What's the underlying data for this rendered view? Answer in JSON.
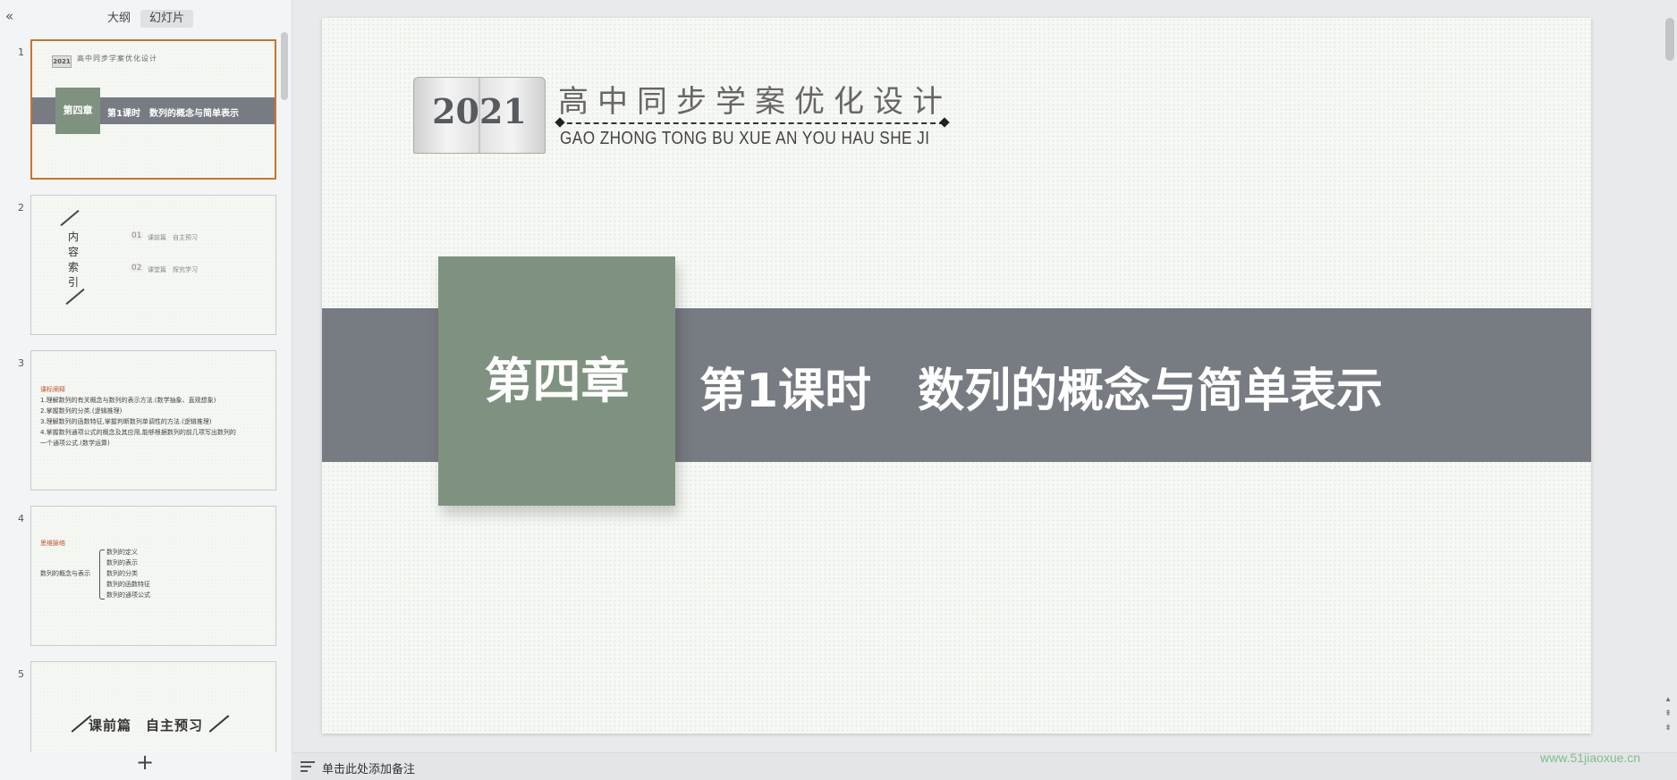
{
  "panel": {
    "tabs": {
      "outline": "大纲",
      "slides": "幻灯片"
    },
    "collapse_icon": "«",
    "add_icon": "+"
  },
  "thumbnails": [
    {
      "num": "1",
      "year": "2021",
      "series": "高中同步学案优化设计",
      "chapter": "第四章",
      "lesson": "第1课时　数列的概念与简单表示"
    },
    {
      "num": "2",
      "vertical": [
        "内",
        "容",
        "索",
        "引"
      ],
      "items": [
        {
          "index": "01",
          "text": "课前篇　自主预习"
        },
        {
          "index": "02",
          "text": "课堂篇　探究学习"
        }
      ]
    },
    {
      "num": "3",
      "heading": "课标阐释",
      "lines": [
        "1.理解数列的有关概念与数列的表示方法.(数学抽象、直观想象)",
        "2.掌握数列的分类.(逻辑推理)",
        "3.理解数列的函数特征,掌握判断数列单调性的方法.(逻辑推理)",
        "4.掌握数列通项公式的概念及其应用,能够根据数列的前几项写出数列的",
        "一个通项公式.(数学运算)"
      ]
    },
    {
      "num": "4",
      "heading": "思维脉络",
      "root": "数列的概念与表示",
      "items": [
        "数列的定义",
        "数列的表示",
        "数列的分类",
        "数列的函数特征",
        "数列的通项公式"
      ]
    },
    {
      "num": "5",
      "title": "课前篇　自主预习"
    }
  ],
  "slide": {
    "year": "2021",
    "series_title": "高中同步学案优化设计",
    "series_pinyin": "GAO ZHONG TONG BU XUE AN YOU HAU SHE JI",
    "chapter": "第四章",
    "lesson": "第1课时　数列的概念与简单表示"
  },
  "nav": {
    "up": "▴",
    "prev": "⇞",
    "next": "⇟"
  },
  "notes": {
    "placeholder": "单击此处添加备注"
  },
  "watermark": "www.51jiaoxue.cn",
  "colors": {
    "band": "#777b82",
    "chapter_box": "#7f9280",
    "active_border": "#c8752c",
    "accent_text": "#c0552a"
  }
}
